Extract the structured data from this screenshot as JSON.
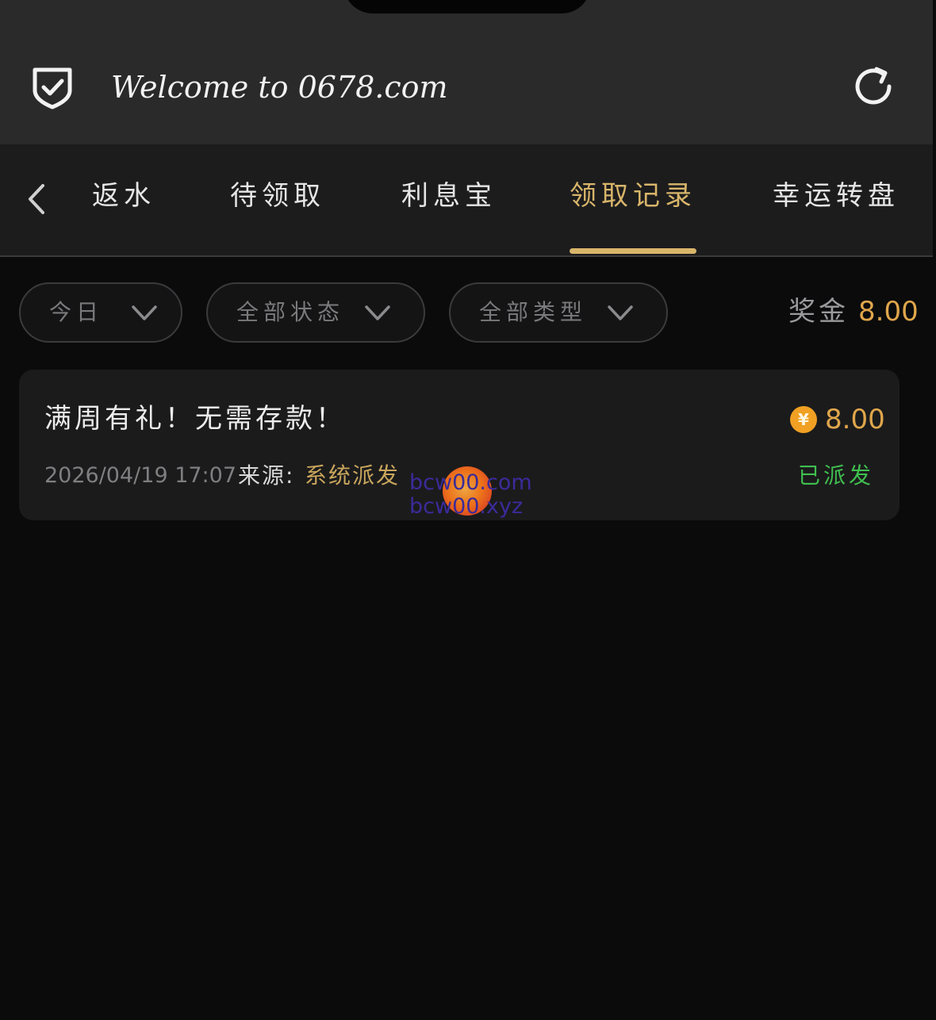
{
  "header": {
    "title": "Welcome to 0678.com",
    "left_icon": "shield-check-icon",
    "right_icon": "refresh-icon"
  },
  "tabs": {
    "back_icon": "chevron-left-icon",
    "items": [
      {
        "label": "返水",
        "active": false
      },
      {
        "label": "待领取",
        "active": false
      },
      {
        "label": "利息宝",
        "active": false
      },
      {
        "label": "领取记录",
        "active": true
      },
      {
        "label": "幸运转盘",
        "active": false
      }
    ]
  },
  "filters": {
    "date": "今日",
    "status": "全部状态",
    "type": "全部类型"
  },
  "bonus": {
    "label": "奖金",
    "value": "8.00"
  },
  "records": [
    {
      "title": "满周有礼！无需存款！",
      "currency_symbol": "¥",
      "amount": "8.00",
      "datetime": "2026/04/19 17:07",
      "source_label": "来源:",
      "source_value": "系统派发",
      "status": "已派发"
    }
  ],
  "watermark": {
    "line1": "bcw00.com",
    "line2": "bcw00.xyz"
  },
  "colors": {
    "accent": "#d8b56a",
    "amount": "#e0a64b",
    "success": "#3fbf4e",
    "background": "#0b0b0c"
  }
}
